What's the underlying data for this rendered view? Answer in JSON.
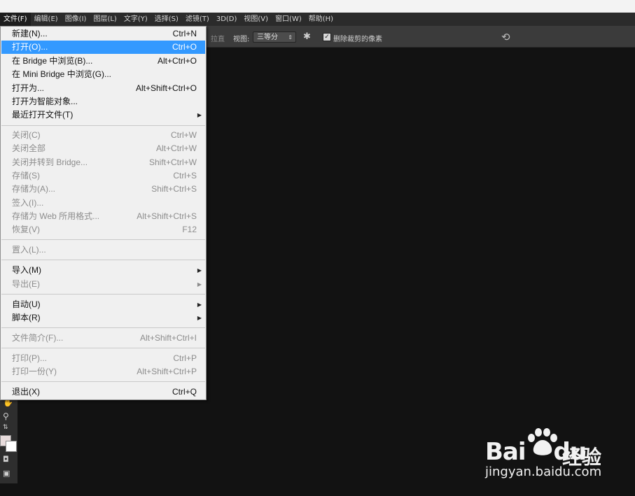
{
  "menubar": [
    "文件(F)",
    "编辑(E)",
    "图像(I)",
    "图层(L)",
    "文字(Y)",
    "选择(S)",
    "滤镜(T)",
    "3D(D)",
    "视图(V)",
    "窗口(W)",
    "帮助(H)"
  ],
  "options": {
    "straighten": "拉直",
    "view_label": "视图:",
    "view_value": "三等分",
    "delete_cropped": "删除裁剪的像素"
  },
  "file_menu": {
    "items": [
      {
        "label": "新建(N)...",
        "shortcut": "Ctrl+N",
        "enabled": true
      },
      {
        "label": "打开(O)...",
        "shortcut": "Ctrl+O",
        "enabled": true,
        "highlighted": true
      },
      {
        "label": "在 Bridge 中浏览(B)...",
        "shortcut": "Alt+Ctrl+O",
        "enabled": true
      },
      {
        "label": "在 Mini Bridge 中浏览(G)...",
        "shortcut": "",
        "enabled": true
      },
      {
        "label": "打开为...",
        "shortcut": "Alt+Shift+Ctrl+O",
        "enabled": true
      },
      {
        "label": "打开为智能对象...",
        "shortcut": "",
        "enabled": true
      },
      {
        "label": "最近打开文件(T)",
        "shortcut": "",
        "enabled": true,
        "submenu": true
      },
      {
        "label": "关闭(C)",
        "shortcut": "Ctrl+W",
        "enabled": false
      },
      {
        "label": "关闭全部",
        "shortcut": "Alt+Ctrl+W",
        "enabled": false
      },
      {
        "label": "关闭并转到 Bridge...",
        "shortcut": "Shift+Ctrl+W",
        "enabled": false
      },
      {
        "label": "存储(S)",
        "shortcut": "Ctrl+S",
        "enabled": false
      },
      {
        "label": "存储为(A)...",
        "shortcut": "Shift+Ctrl+S",
        "enabled": false
      },
      {
        "label": "签入(I)...",
        "shortcut": "",
        "enabled": false
      },
      {
        "label": "存储为 Web 所用格式...",
        "shortcut": "Alt+Shift+Ctrl+S",
        "enabled": false
      },
      {
        "label": "恢复(V)",
        "shortcut": "F12",
        "enabled": false
      },
      {
        "label": "置入(L)...",
        "shortcut": "",
        "enabled": false
      },
      {
        "label": "导入(M)",
        "shortcut": "",
        "enabled": true,
        "submenu": true
      },
      {
        "label": "导出(E)",
        "shortcut": "",
        "enabled": false,
        "submenu": true
      },
      {
        "label": "自动(U)",
        "shortcut": "",
        "enabled": true,
        "submenu": true
      },
      {
        "label": "脚本(R)",
        "shortcut": "",
        "enabled": true,
        "submenu": true
      },
      {
        "label": "文件简介(F)...",
        "shortcut": "Alt+Shift+Ctrl+I",
        "enabled": false
      },
      {
        "label": "打印(P)...",
        "shortcut": "Ctrl+P",
        "enabled": false
      },
      {
        "label": "打印一份(Y)",
        "shortcut": "Alt+Shift+Ctrl+P",
        "enabled": false
      },
      {
        "label": "退出(X)",
        "shortcut": "Ctrl+Q",
        "enabled": true
      }
    ]
  },
  "watermark": {
    "logo": "Bai",
    "logo_tail": "du",
    "cn": "经验",
    "url": "jingyan.baidu.com"
  }
}
